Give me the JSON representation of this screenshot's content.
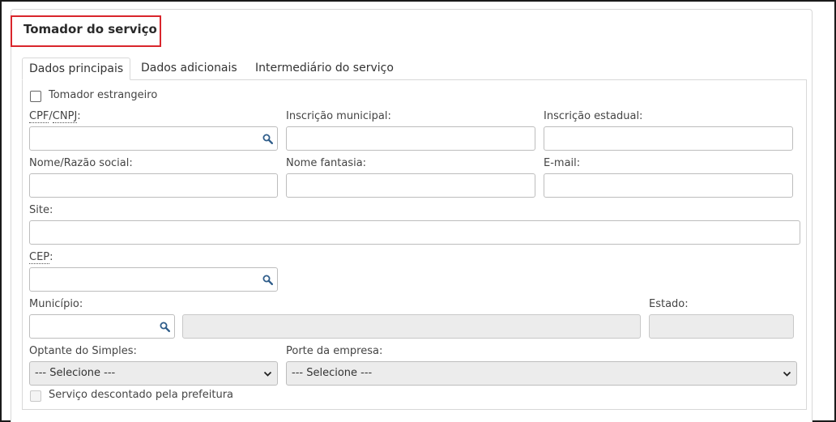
{
  "section_title": "Tomador do serviço",
  "tabs": [
    {
      "label": "Dados principais",
      "active": true
    },
    {
      "label": "Dados adicionais",
      "active": false
    },
    {
      "label": "Intermediário do serviço",
      "active": false
    }
  ],
  "form": {
    "tomador_estrangeiro": "Tomador estrangeiro",
    "cpf_abbr_1": "CPF",
    "cpf_sep": "/",
    "cpf_abbr_2": "CNPJ",
    "cpf_suffix": ":",
    "inscricao_municipal": "Inscrição municipal:",
    "inscricao_estadual": "Inscrição estadual:",
    "nome_razao": "Nome/Razão social:",
    "nome_fantasia": "Nome fantasia:",
    "email": "E-mail:",
    "site": "Site:",
    "cep_abbr": "CEP",
    "cep_suffix": ":",
    "municipio": "Município:",
    "estado": "Estado:",
    "optante_simples": "Optante do Simples:",
    "porte_empresa": "Porte da empresa:",
    "select_placeholder": "--- Selecione ---",
    "servico_descontado": "Serviço descontado pela prefeitura"
  },
  "icons": {
    "search": "search-icon",
    "dropdown": "chevron-down-icon"
  },
  "colors": {
    "highlight_border": "#d9262c",
    "icon_blue": "#2f5d8a"
  }
}
